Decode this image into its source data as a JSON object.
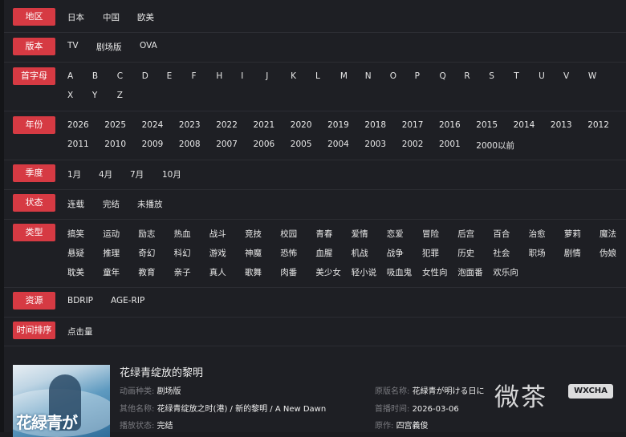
{
  "filters": {
    "region": {
      "label": "地区",
      "items": [
        "日本",
        "中国",
        "欧美"
      ]
    },
    "version": {
      "label": "版本",
      "items": [
        "TV",
        "剧场版",
        "OVA"
      ]
    },
    "letter": {
      "label": "首字母",
      "items": [
        "A",
        "B",
        "C",
        "D",
        "E",
        "F",
        "H",
        "I",
        "J",
        "K",
        "L",
        "M",
        "N",
        "O",
        "P",
        "Q",
        "R",
        "S",
        "T",
        "U",
        "V",
        "W",
        "X",
        "Y",
        "Z"
      ]
    },
    "year": {
      "label": "年份",
      "items": [
        "2026",
        "2025",
        "2024",
        "2023",
        "2022",
        "2021",
        "2020",
        "2019",
        "2018",
        "2017",
        "2016",
        "2015",
        "2014",
        "2013",
        "2012",
        "2011",
        "2010",
        "2009",
        "2008",
        "2007",
        "2006",
        "2005",
        "2004",
        "2003",
        "2002",
        "2001",
        "2000以前"
      ]
    },
    "season": {
      "label": "季度",
      "items": [
        "1月",
        "4月",
        "7月",
        "10月"
      ]
    },
    "status": {
      "label": "状态",
      "items": [
        "连载",
        "完结",
        "未播放"
      ]
    },
    "genre": {
      "label": "类型",
      "items": [
        "搞笑",
        "运动",
        "励志",
        "热血",
        "战斗",
        "竞技",
        "校园",
        "青春",
        "爱情",
        "恋爱",
        "冒险",
        "后宫",
        "百合",
        "治愈",
        "萝莉",
        "魔法",
        "悬疑",
        "推理",
        "奇幻",
        "科幻",
        "游戏",
        "神魔",
        "恐怖",
        "血腥",
        "机战",
        "战争",
        "犯罪",
        "历史",
        "社会",
        "职场",
        "剧情",
        "伪娘",
        "耽美",
        "童年",
        "教育",
        "亲子",
        "真人",
        "歌舞",
        "肉番",
        "美少女",
        "轻小说",
        "吸血鬼",
        "女性向",
        "泡面番",
        "欢乐向"
      ]
    },
    "resource": {
      "label": "资源",
      "items": [
        "BDRIP",
        "AGE-RIP"
      ]
    },
    "sort": {
      "label": "时间排序",
      "items": [
        "点击量"
      ]
    }
  },
  "card": {
    "poster_text": "花緑青が",
    "title": "花绿青绽放的黎明",
    "type_key": "动画种类:",
    "type_val": "剧场版",
    "alias_key": "其他名称:",
    "alias_val": "花绿青绽放之时(港) / 新的黎明 / A New Dawn",
    "play_key": "播放状态:",
    "play_val": "完结",
    "orig_key": "原版名称:",
    "orig_val": "花緑青が明ける日に",
    "date_key": "首播时间:",
    "date_val": "2026-03-06",
    "author_key": "原作:",
    "author_val": "四宫義俊"
  },
  "watermark": {
    "cn": "微茶",
    "en": "WXCHA"
  },
  "colors": {
    "accent": "#d63a43",
    "background": "#1e1f24"
  }
}
